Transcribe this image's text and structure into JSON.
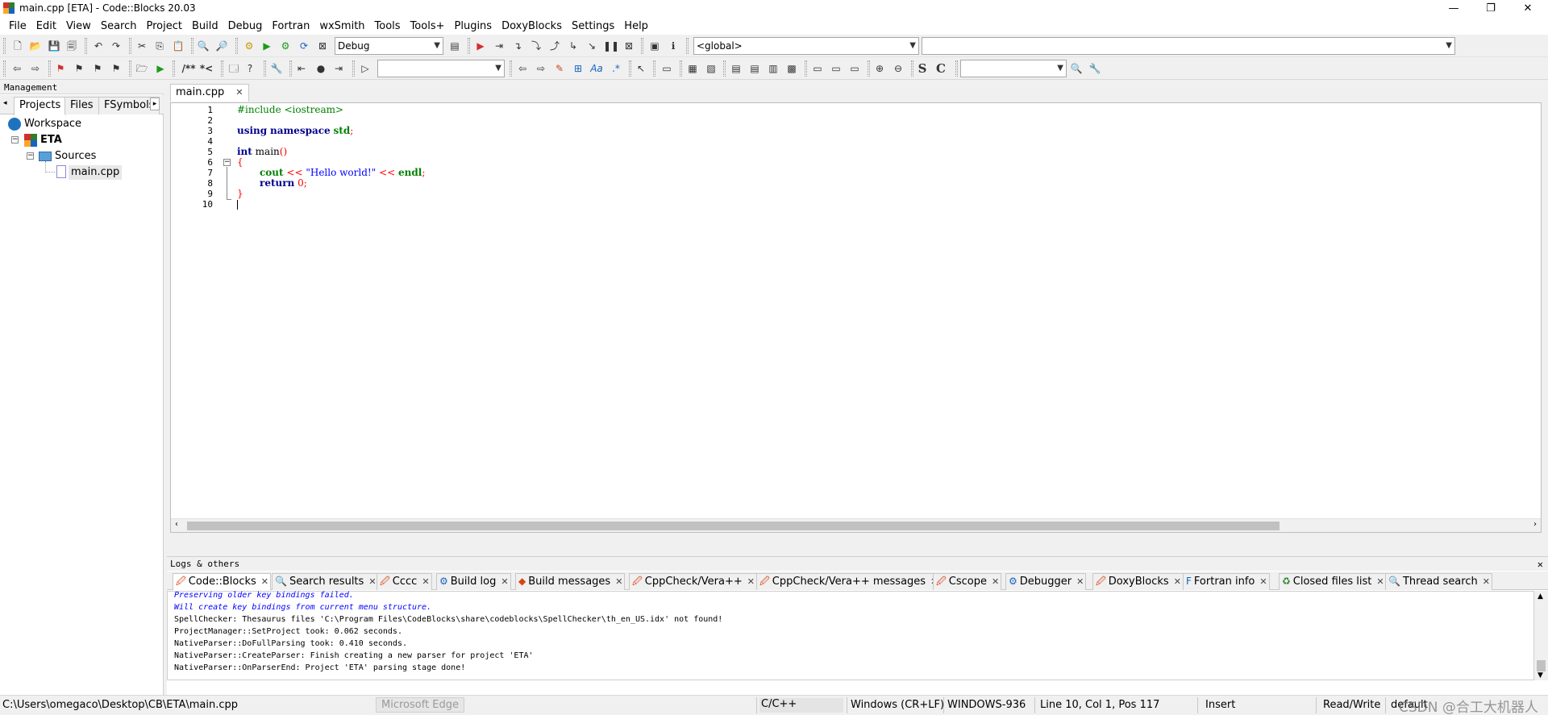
{
  "window": {
    "title": "main.cpp [ETA] - Code::Blocks 20.03",
    "minimize": "—",
    "restore": "❐",
    "close": "✕"
  },
  "menu": [
    "File",
    "Edit",
    "View",
    "Search",
    "Project",
    "Build",
    "Debug",
    "Fortran",
    "wxSmith",
    "Tools",
    "Tools+",
    "Plugins",
    "DoxyBlocks",
    "Settings",
    "Help"
  ],
  "toolbar": {
    "build_target": "Debug",
    "scope": "<global>",
    "function": "",
    "search2_text": "",
    "bold_s": "S",
    "bold_c": "C",
    "comment_block": "/**",
    "comment_line": "*<"
  },
  "management": {
    "header": "Management",
    "tabs": [
      "Projects",
      "Files",
      "FSymbols"
    ],
    "tree": {
      "workspace": "Workspace",
      "project": "ETA",
      "folder": "Sources",
      "file": "main.cpp"
    }
  },
  "editor": {
    "tab": "main.cpp",
    "tab_close": "✕",
    "line_numbers": [
      "1",
      "2",
      "3",
      "4",
      "5",
      "6",
      "7",
      "8",
      "9",
      "10"
    ],
    "code": {
      "l1": "#include <iostream>",
      "l3_kw1": "using",
      "l3_kw2": "namespace",
      "l3_id": "std",
      "l3_semi": ";",
      "l5_kw": "int",
      "l5_id": "main",
      "l5_paren": "()",
      "l6_brace": "{",
      "l7_id": "cout",
      "l7_op1": "<<",
      "l7_str": "\"Hello world!\"",
      "l7_op2": "<<",
      "l7_endl": "endl",
      "l7_semi": ";",
      "l8_kw": "return",
      "l8_num": "0",
      "l8_semi": ";",
      "l9_brace": "}"
    }
  },
  "logs": {
    "header": "Logs & others",
    "close": "✕",
    "tabs": [
      {
        "label": "Code::Blocks",
        "icon": "document-edit-icon"
      },
      {
        "label": "Search results",
        "icon": "magnifier-icon"
      },
      {
        "label": "Cccc",
        "icon": "document-edit-icon"
      },
      {
        "label": "Build log",
        "icon": "gear-icon"
      },
      {
        "label": "Build messages",
        "icon": "diamond-icon"
      },
      {
        "label": "CppCheck/Vera++",
        "icon": "document-edit-icon"
      },
      {
        "label": "CppCheck/Vera++ messages",
        "icon": "document-edit-icon"
      },
      {
        "label": "Cscope",
        "icon": "document-edit-icon"
      },
      {
        "label": "Debugger",
        "icon": "gear-icon"
      },
      {
        "label": "DoxyBlocks",
        "icon": "document-edit-icon"
      },
      {
        "label": "Fortran info",
        "icon": "fortran-file-icon"
      },
      {
        "label": "Closed files list",
        "icon": "recycle-icon"
      },
      {
        "label": "Thread search",
        "icon": "magnifier-icon"
      }
    ],
    "lines": [
      "Preserving older key bindings failed.",
      "Will create key bindings from current menu structure.",
      "SpellChecker: Thesaurus files 'C:\\Program Files\\CodeBlocks\\share\\codeblocks\\SpellChecker\\th_en_US.idx' not found!",
      "ProjectManager::SetProject took: 0.062 seconds.",
      "NativeParser::DoFullParsing took: 0.410 seconds.",
      "NativeParser::CreateParser: Finish creating a new parser for project 'ETA'",
      "NativeParser::OnParserEnd: Project 'ETA' parsing stage done!"
    ]
  },
  "status": {
    "path": "C:\\Users\\omegaco\\Desktop\\CB\\ETA\\main.cpp",
    "taskbar_hint": "Microsoft Edge",
    "language": "C/C++",
    "eol": "Windows (CR+LF)",
    "encoding": "WINDOWS-936",
    "position": "Line 10, Col 1, Pos 117",
    "mode": "Insert",
    "access": "Read/Write",
    "profile": "default",
    "watermark": "CSDN @合工大机器人"
  }
}
